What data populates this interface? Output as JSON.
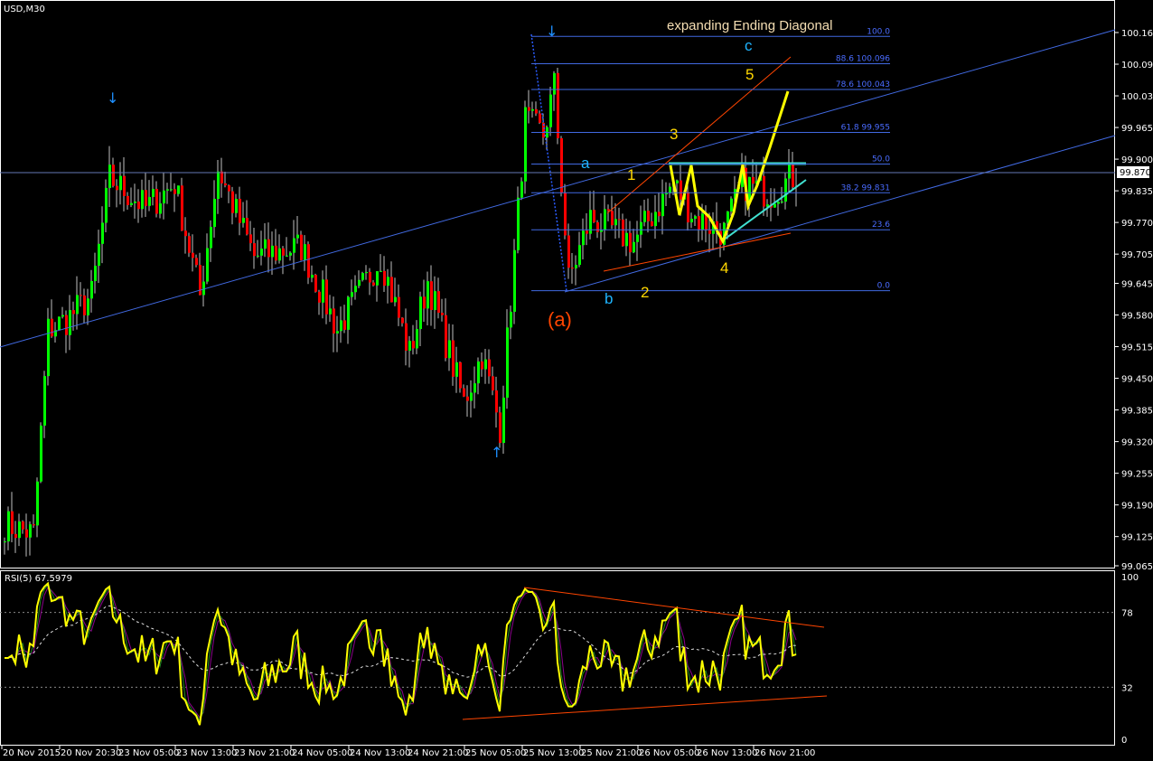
{
  "chart_data": {
    "type": "candlestick",
    "symbol_label": "USD,M30",
    "title": "expanding Ending Diagonal",
    "y_ticks": [
      "100.160",
      "100.095",
      "100.030",
      "99.965",
      "99.900",
      "99.835",
      "99.770",
      "99.705",
      "99.645",
      "99.580",
      "99.515",
      "99.450",
      "99.385",
      "99.320",
      "99.255",
      "99.190",
      "99.125",
      "99.065"
    ],
    "ylim": [
      99.065,
      100.16
    ],
    "current_price": "99.870",
    "x_ticks": [
      "20 Nov 2015",
      "20 Nov 20:30",
      "23 Nov 05:00",
      "23 Nov 13:00",
      "23 Nov 21:00",
      "24 Nov 05:00",
      "24 Nov 13:00",
      "24 Nov 21:00",
      "25 Nov 05:00",
      "25 Nov 13:00",
      "25 Nov 21:00",
      "26 Nov 05:00",
      "26 Nov 13:00",
      "26 Nov 21:00"
    ],
    "close_path": [
      [
        0,
        99.15
      ],
      [
        8,
        99.13
      ],
      [
        12,
        99.55
      ],
      [
        17,
        99.57
      ],
      [
        24,
        99.62
      ],
      [
        29,
        99.86
      ],
      [
        39,
        99.8
      ],
      [
        47,
        99.85
      ],
      [
        54,
        99.62
      ],
      [
        59,
        99.88
      ],
      [
        69,
        99.7
      ],
      [
        82,
        99.72
      ],
      [
        92,
        99.55
      ],
      [
        104,
        99.7
      ],
      [
        112,
        99.5
      ],
      [
        117,
        99.65
      ],
      [
        127,
        99.4
      ],
      [
        132,
        99.5
      ],
      [
        137,
        99.35
      ],
      [
        141,
        99.7
      ],
      [
        144,
        99.98
      ],
      [
        149,
        99.95
      ],
      [
        152,
        100.05
      ],
      [
        154,
        99.85
      ],
      [
        156,
        99.65
      ],
      [
        162,
        99.78
      ],
      [
        174,
        99.73
      ],
      [
        185,
        99.85
      ],
      [
        191,
        99.78
      ],
      [
        199,
        99.75
      ],
      [
        204,
        99.85
      ],
      [
        212,
        99.83
      ],
      [
        219,
        99.87
      ]
    ],
    "fib_levels": [
      {
        "label": "100.0",
        "price": 100.152
      },
      {
        "label": "88.6 100.096",
        "price": 100.096
      },
      {
        "label": "78.6 100.043",
        "price": 100.043
      },
      {
        "label": "61.8 99.955",
        "price": 99.955
      },
      {
        "label": "50.0",
        "price": 99.89
      },
      {
        "label": "38.2 99.831",
        "price": 99.831
      },
      {
        "label": "23.6",
        "price": 99.755
      },
      {
        "label": "0.0",
        "price": 99.63
      }
    ],
    "wave_labels": {
      "a": "a",
      "b": "b",
      "c": "c",
      "w1": "1",
      "w2": "2",
      "w3": "3",
      "w4": "4",
      "w5": "5",
      "big_a": "(a)"
    },
    "rsi": {
      "label": "RSI(5) 67.5979",
      "ticks": [
        "100",
        "78",
        "32",
        "0"
      ],
      "levels": [
        100,
        78,
        32,
        0
      ]
    },
    "colors": {
      "up": "#00ff00",
      "down": "#ff0000",
      "wick": "#c0c0c0",
      "fib": "#4169e1",
      "rsi": "#ffff00"
    }
  }
}
